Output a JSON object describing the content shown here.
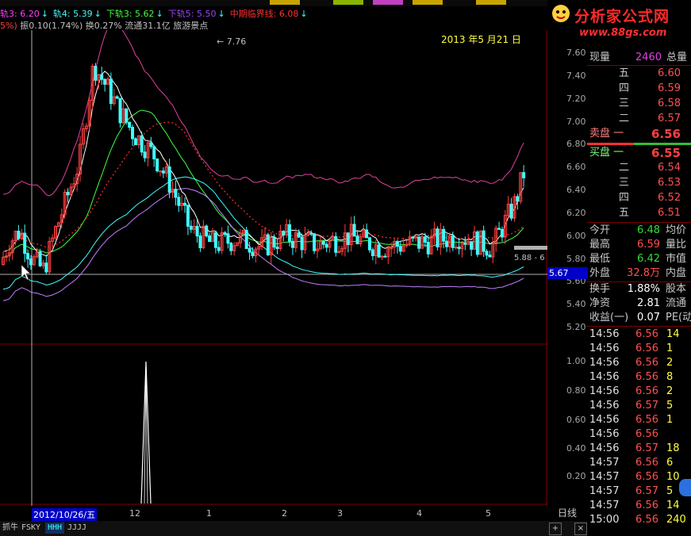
{
  "legend": {
    "items": [
      {
        "text": "轨3: 6.20",
        "color": "#ff40ff",
        "arrow": "↓"
      },
      {
        "text": "轨4: 5.39",
        "color": "#40ffff",
        "arrow": "↓"
      },
      {
        "text": "下轨3: 5.62",
        "color": "#40ff40",
        "arrow": "↓"
      },
      {
        "text": "下轨5: 5.50",
        "color": "#a040ff",
        "arrow": "↓"
      },
      {
        "text": "中期临界线: 6.08",
        "color": "#ff3030",
        "arrow": "↓"
      }
    ]
  },
  "info": {
    "left": "5%)",
    "amplitude": "振0.10(1.74%)",
    "turnover": "换0.27%",
    "float": "流通31.1亿",
    "sector": "旅游景点"
  },
  "logo": {
    "title": "分析家公式网",
    "url": "www.88gs.com"
  },
  "chart": {
    "date_label": "2013 年5 月21 日",
    "high_label": "7.76",
    "current_price_tag": "5.67",
    "last_label": "5.88 - 6",
    "price_ticks": [
      "7.60",
      "7.40",
      "7.20",
      "7.00",
      "6.80",
      "6.60",
      "6.40",
      "6.20",
      "6.00",
      "5.80",
      "5.60",
      "5.40",
      "5.20"
    ],
    "indicator_ticks": [
      "1.00",
      "0.80",
      "0.60",
      "0.40",
      "0.20"
    ],
    "x_labels": [
      "2012/10/26/五",
      "12",
      "1",
      "2",
      "3",
      "4",
      "5"
    ],
    "period": "日线"
  },
  "tabs": [
    "抓牛",
    "FSKY",
    "HHH",
    "JJJJ"
  ],
  "panel": {
    "xianliang": {
      "label": "现量",
      "value": "2460",
      "right": "总量"
    },
    "asks": [
      {
        "label": "五",
        "price": "6.60"
      },
      {
        "label": "四",
        "price": "6.59"
      },
      {
        "label": "三",
        "price": "6.58"
      },
      {
        "label": "二",
        "price": "6.57"
      },
      {
        "label": "卖盘 一",
        "price": "6.56"
      }
    ],
    "bids": [
      {
        "label": "买盘 一",
        "price": "6.55"
      },
      {
        "label": "二",
        "price": "6.54"
      },
      {
        "label": "三",
        "price": "6.53"
      },
      {
        "label": "四",
        "price": "6.52"
      },
      {
        "label": "五",
        "price": "6.51"
      }
    ],
    "stats": [
      {
        "label": "今开",
        "value": "6.48",
        "right": "均价",
        "color": "green"
      },
      {
        "label": "最高",
        "value": "6.59",
        "right": "量比",
        "color": "red"
      },
      {
        "label": "最低",
        "value": "6.42",
        "right": "市值",
        "color": "green"
      },
      {
        "label": "外盘",
        "value": "32.8万",
        "right": "内盘",
        "color": "red"
      },
      {
        "label": "换手",
        "value": "1.88%",
        "right": "股本",
        "color": "white"
      },
      {
        "label": "净资",
        "value": "2.81",
        "right": "流通",
        "color": "white"
      },
      {
        "label": "收益(一)",
        "value": "0.07",
        "right": "PE(动",
        "color": "white"
      }
    ],
    "ticks": [
      {
        "time": "14:56",
        "price": "6.56",
        "vol": "14"
      },
      {
        "time": "14:56",
        "price": "6.56",
        "vol": "1"
      },
      {
        "time": "14:56",
        "price": "6.56",
        "vol": "2"
      },
      {
        "time": "14:56",
        "price": "6.56",
        "vol": "8"
      },
      {
        "time": "14:56",
        "price": "6.56",
        "vol": "2"
      },
      {
        "time": "14:56",
        "price": "6.57",
        "vol": "5"
      },
      {
        "time": "14:56",
        "price": "6.56",
        "vol": "1"
      },
      {
        "time": "14:56",
        "price": "6.56",
        "vol": ""
      },
      {
        "time": "14:56",
        "price": "6.57",
        "vol": "18"
      },
      {
        "time": "14:57",
        "price": "6.56",
        "vol": "6"
      },
      {
        "time": "14:57",
        "price": "6.56",
        "vol": "10"
      },
      {
        "time": "14:57",
        "price": "6.57",
        "vol": "5"
      },
      {
        "time": "14:57",
        "price": "6.56",
        "vol": "14"
      },
      {
        "time": "15:00",
        "price": "6.56",
        "vol": "240"
      }
    ]
  },
  "colors": {
    "up": "#ff5050",
    "down": "#40ffff",
    "bg": "#000000",
    "grid": "#800000"
  }
}
